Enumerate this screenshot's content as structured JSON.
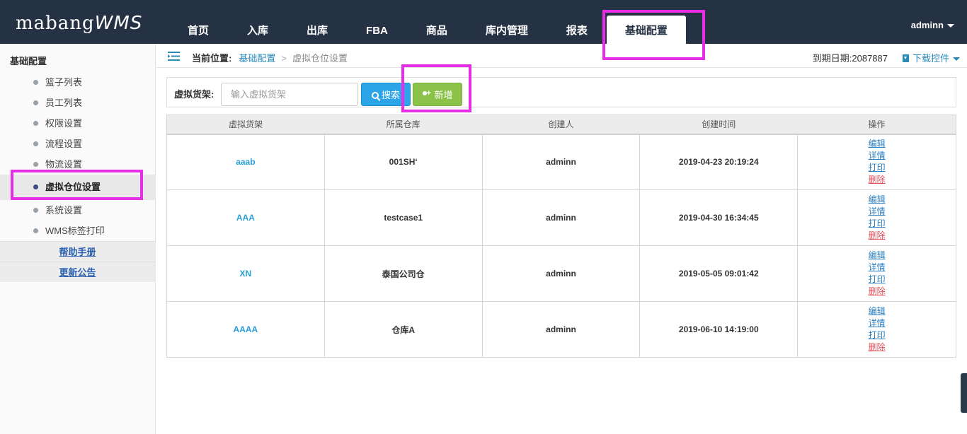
{
  "app": {
    "logo_main": "mabang",
    "logo_suffix": "WMS"
  },
  "nav": [
    {
      "label": "首页"
    },
    {
      "label": "入库"
    },
    {
      "label": "出库"
    },
    {
      "label": "FBA"
    },
    {
      "label": "商品"
    },
    {
      "label": "库内管理"
    },
    {
      "label": "报表"
    },
    {
      "label": "基础配置",
      "active": true
    }
  ],
  "user": {
    "name": "adminn"
  },
  "sidebar": {
    "title": "基础配置",
    "items": [
      {
        "label": "篮子列表"
      },
      {
        "label": "员工列表"
      },
      {
        "label": "权限设置"
      },
      {
        "label": "流程设置"
      },
      {
        "label": "物流设置"
      },
      {
        "label": "虚拟仓位设置",
        "active": true
      },
      {
        "label": "系统设置"
      },
      {
        "label": "WMS标签打印"
      }
    ],
    "links": [
      {
        "label": "帮助手册"
      },
      {
        "label": "更新公告"
      }
    ]
  },
  "breadcrumb": {
    "label": "当前位置:",
    "level1": "基础配置",
    "level2": "虚拟仓位设置"
  },
  "expiry": {
    "text": "到期日期:2087887"
  },
  "download": {
    "label": "下载控件"
  },
  "search": {
    "label": "虚拟货架:",
    "placeholder": "输入虚拟货架",
    "search_label": "搜索",
    "add_label": "新增"
  },
  "table": {
    "headers": [
      "虚拟货架",
      "所属仓库",
      "创建人",
      "创建时间",
      "操作"
    ],
    "rows": [
      {
        "shelf": "aaab",
        "warehouse": "001SH‘",
        "creator": "adminn",
        "created": "2019-04-23 20:19:24"
      },
      {
        "shelf": "AAA",
        "warehouse": "testcase1",
        "creator": "adminn",
        "created": "2019-04-30 16:34:45"
      },
      {
        "shelf": "XN",
        "warehouse": "泰国公司仓",
        "creator": "adminn",
        "created": "2019-05-05 09:01:42"
      },
      {
        "shelf": "AAAA",
        "warehouse": "仓库A",
        "creator": "adminn",
        "created": "2019-06-10 14:19:00"
      }
    ],
    "ops": {
      "edit": "编辑",
      "detail": "详情",
      "print": "打印",
      "delete": "删除"
    }
  },
  "colors": {
    "topbar": "#243244",
    "accent": "#2a9fd6",
    "add_button": "#8bc24a",
    "highlight": "#e52ee5"
  }
}
